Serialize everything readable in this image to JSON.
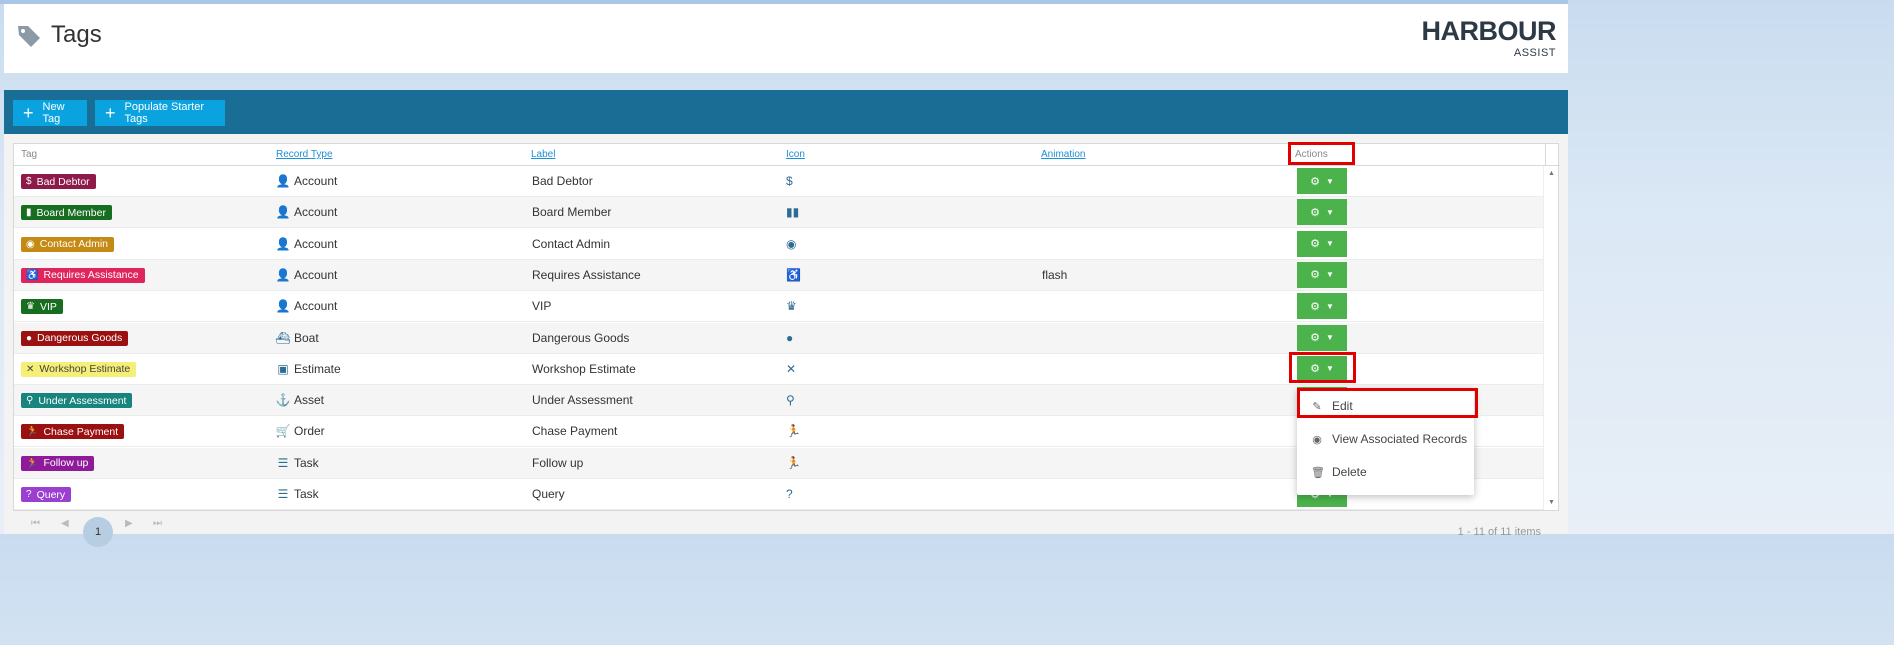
{
  "page": {
    "title": "Tags"
  },
  "logo": {
    "name": "HARBOUR",
    "sub": "ASSIST"
  },
  "toolbar": {
    "new_tag": "New Tag",
    "populate": "Populate Starter Tags"
  },
  "grid": {
    "headers": {
      "tag": "Tag",
      "record_type": "Record Type",
      "label": "Label",
      "icon": "Icon",
      "animation": "Animation",
      "actions": "Actions"
    },
    "rows": [
      {
        "tag": "Bad Debtor",
        "tag_color": "#8e1a4a",
        "tag_text_color": "#ffffff",
        "record_type": "Account",
        "rt_icon": "user-icon",
        "label": "Bad Debtor",
        "icon": "hand-dollar-icon",
        "animation": ""
      },
      {
        "tag": "Board Member",
        "tag_color": "#176e21",
        "tag_text_color": "#ffffff",
        "record_type": "Account",
        "rt_icon": "user-icon",
        "label": "Board Member",
        "icon": "people-group-icon",
        "animation": ""
      },
      {
        "tag": "Contact Admin",
        "tag_color": "#c58a13",
        "tag_text_color": "#ffffff",
        "record_type": "Account",
        "rt_icon": "user-icon",
        "label": "Contact Admin",
        "icon": "telegram-icon",
        "animation": ""
      },
      {
        "tag": "Requires Assistance",
        "tag_color": "#e0255c",
        "tag_text_color": "#ffffff",
        "record_type": "Account",
        "rt_icon": "user-icon",
        "label": "Requires Assistance",
        "icon": "wheelchair-icon",
        "animation": "flash"
      },
      {
        "tag": "VIP",
        "tag_color": "#176e21",
        "tag_text_color": "#ffffff",
        "record_type": "Account",
        "rt_icon": "user-icon",
        "label": "VIP",
        "icon": "crown-icon",
        "animation": ""
      },
      {
        "tag": "Dangerous Goods",
        "tag_color": "#9b1010",
        "tag_text_color": "#ffffff",
        "record_type": "Boat",
        "rt_icon": "boat-icon",
        "label": "Dangerous Goods",
        "icon": "bomb-icon",
        "animation": ""
      },
      {
        "tag": "Workshop Estimate",
        "tag_color": "#f5ef78",
        "tag_text_color": "#444444",
        "record_type": "Estimate",
        "rt_icon": "estimate-icon",
        "label": "Workshop Estimate",
        "icon": "tools-icon",
        "animation": ""
      },
      {
        "tag": "Under Assessment",
        "tag_color": "#17847e",
        "tag_text_color": "#ffffff",
        "record_type": "Asset",
        "rt_icon": "anchor-icon",
        "label": "Under Assessment",
        "icon": "magnifier-icon",
        "animation": ""
      },
      {
        "tag": "Chase Payment",
        "tag_color": "#9b1010",
        "tag_text_color": "#ffffff",
        "record_type": "Order",
        "rt_icon": "cart-icon",
        "label": "Chase Payment",
        "icon": "running-icon",
        "animation": ""
      },
      {
        "tag": "Follow up",
        "tag_color": "#8f1a9a",
        "tag_text_color": "#ffffff",
        "record_type": "Task",
        "rt_icon": "tasks-icon",
        "label": "Follow up",
        "icon": "running-icon",
        "animation": ""
      },
      {
        "tag": "Query",
        "tag_color": "#9b3fd0",
        "tag_text_color": "#ffffff",
        "record_type": "Task",
        "rt_icon": "tasks-icon",
        "label": "Query",
        "icon": "question-circle-icon",
        "animation": ""
      }
    ]
  },
  "menu": {
    "edit": "Edit",
    "view": "View Associated Records",
    "delete": "Delete"
  },
  "pager": {
    "current": "1",
    "info": "1 - 11 of 11 items"
  },
  "colors": {
    "toolbar": "#1a6e96",
    "button": "#0aa3e0",
    "action": "#4cb34c",
    "highlight": "#e00000"
  }
}
